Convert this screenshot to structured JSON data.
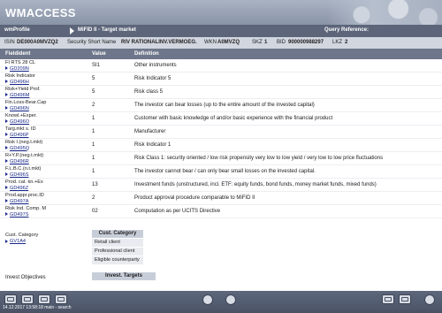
{
  "header": {
    "title": "WMACCESS"
  },
  "tabbar": {
    "left": "wmProfile",
    "title": "MiFID II - Target market",
    "right": "Query Reference:"
  },
  "security": {
    "isin_label": "ISIN",
    "isin": "DE000A0MVZQ2",
    "short_name_label": "Security Short Name",
    "short_name": "RIV RATIONALINV.VERMOEG.",
    "wkn_label": "WKN",
    "wkn": "A0MVZQ",
    "skz_label": "SKZ",
    "skz": "1",
    "bid_label": "BID",
    "bid": "900000988297",
    "lkz_label": "LKZ",
    "lkz": "2"
  },
  "columns": {
    "fieldident": "Fieldident",
    "value": "Value",
    "definition": "Definition"
  },
  "rows": [
    {
      "name": "FI RTS 28 CL",
      "code": "GD209N",
      "value": "SI1",
      "definition": "Other instruments"
    },
    {
      "name": "Risk Indicator",
      "code": "GD496H",
      "value": "5",
      "definition": "Risk Indicator 5"
    },
    {
      "name": "Risk+Yield Prof.",
      "code": "GD496M",
      "value": "5",
      "definition": "Risk class 5"
    },
    {
      "name": "Fin.Loss-Bear.Cap",
      "code": "GD496N",
      "value": "2",
      "definition": "The investor can bear losses (up to the entire amount of the invested capital)"
    },
    {
      "name": "Knowl.+Exper.",
      "code": "GD496O",
      "value": "1",
      "definition": "Customer with basic knowledge of and/or basic experience with the financial product"
    },
    {
      "name": "Targ.mkt s. ID",
      "code": "GD496P",
      "value": "1",
      "definition": "Manufacturer"
    },
    {
      "name": "Risk I.(neg.t.mkt)",
      "code": "GD495Q",
      "value": "1",
      "definition": "Risk Indicator 1"
    },
    {
      "name": "R+Y.P.(neg.t.mkt)",
      "code": "GD496R",
      "value": "1",
      "definition": "Risk Class 1: security oriented / low risk propensity very low to low yield / very low to low price fluctuations"
    },
    {
      "name": "F.L.B.C.(n.t.mkt)",
      "code": "GD496S",
      "value": "1",
      "definition": "The investor cannot bear / can only bear small losses on the invested capital."
    },
    {
      "name": "Prod. cat. kn.+Ex",
      "code": "GD496Z",
      "value": "13",
      "definition": "Investment funds (unstructured, incl. ETF: equity funds, bond funds, money market funds, mixed funds)"
    },
    {
      "name": "Prod.appr.proc.ID",
      "code": "GD497A",
      "value": "2",
      "definition": "Product approval procedure comparable to MiFID II"
    },
    {
      "name": "Risk Ind. Comp. M",
      "code": "GD497S",
      "value": "02",
      "definition": "Computation as per UCITS Directive"
    }
  ],
  "customer_category": {
    "name": "Cust. Category",
    "code": "GV1A4",
    "header": "Cust. Category",
    "items": [
      "Retail client",
      "Professional client",
      "Eligible counterparty"
    ]
  },
  "invest": {
    "name": "Invest Objectives",
    "header": "Invest. Targets"
  },
  "status": "14.12.2017 13:58:18 main - search"
}
